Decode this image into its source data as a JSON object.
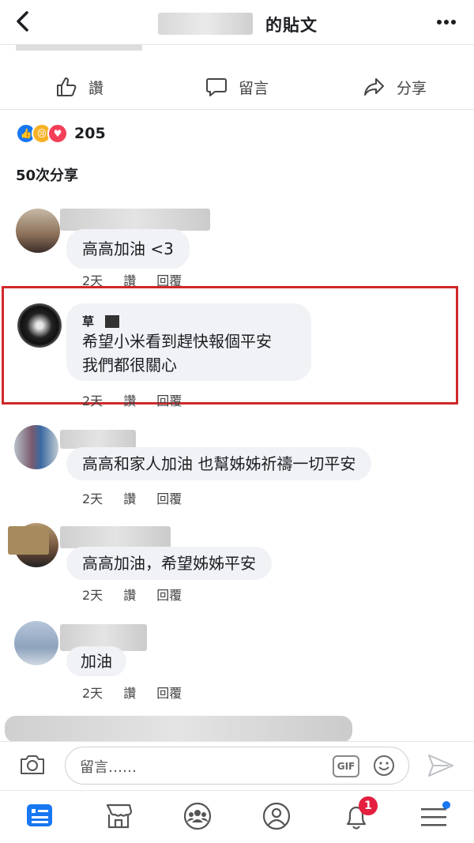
{
  "header": {
    "title": "的貼文"
  },
  "actions": {
    "like": "讚",
    "comment": "留言",
    "share": "分享"
  },
  "reactions": {
    "count": "205",
    "shares": "50次分享"
  },
  "comments": [
    {
      "name": "",
      "text": "高高加油 <3",
      "time": "2天",
      "like": "讚",
      "reply": "回覆"
    },
    {
      "name": "草",
      "text": "希望小米看到趕快報個平安",
      "text2": "我們都很關心",
      "time": "2天",
      "like": "讚",
      "reply": "回覆"
    },
    {
      "name": "",
      "text": "高高和家人加油 也幫姊姊祈禱一切平安",
      "time": "2天",
      "like": "讚",
      "reply": "回覆"
    },
    {
      "name": "",
      "text": "高高加油，希望姊姊平安",
      "time": "2天",
      "like": "讚",
      "reply": "回覆"
    },
    {
      "name": "",
      "text": "加油",
      "time": "2天",
      "like": "讚",
      "reply": "回覆"
    }
  ],
  "compose": {
    "placeholder": "留言……",
    "gif": "GIF"
  },
  "nav": {
    "badge": "1"
  }
}
